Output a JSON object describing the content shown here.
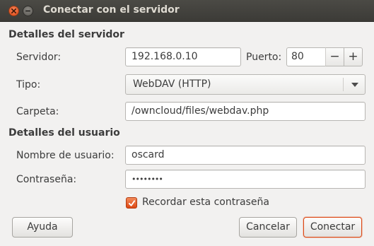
{
  "window": {
    "title": "Conectar con el servidor"
  },
  "server_details": {
    "heading": "Detalles del servidor",
    "server_label": "Servidor:",
    "server_value": "192.168.0.10",
    "port_label": "Puerto:",
    "port_value": "80",
    "type_label": "Tipo:",
    "type_value": "WebDAV (HTTP)",
    "folder_label": "Carpeta:",
    "folder_value": "/owncloud/files/webdav.php"
  },
  "user_details": {
    "heading": "Detalles del usuario",
    "username_label": "Nombre de usuario:",
    "username_value": "oscard",
    "password_label": "Contraseña:",
    "password_value": "••••••••",
    "remember_label": "Recordar esta contraseña",
    "remember_checked": true
  },
  "actions": {
    "help": "Ayuda",
    "cancel": "Cancelar",
    "connect": "Conectar"
  },
  "spin": {
    "minus": "−",
    "plus": "+"
  },
  "colors": {
    "accent": "#dd4814",
    "window_bg": "#f2f1f0",
    "titlebar_bg": "#3c3b37"
  }
}
